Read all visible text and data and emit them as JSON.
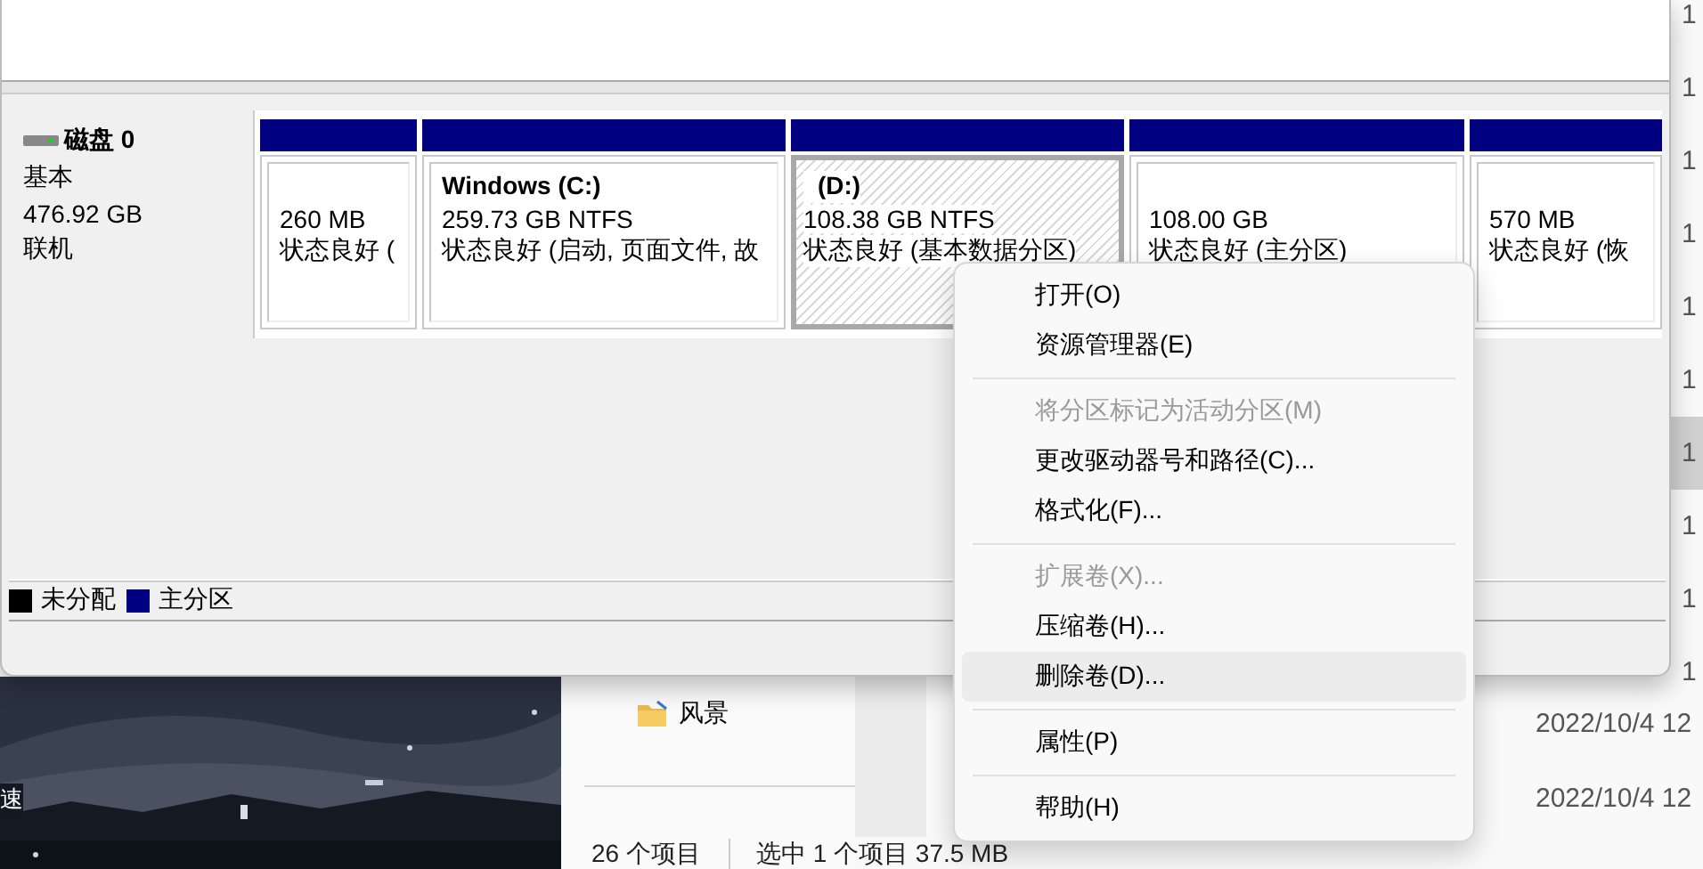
{
  "background_window": {
    "right_column": [
      {
        "text": "1",
        "selected": false
      },
      {
        "text": "1",
        "selected": false
      },
      {
        "text": "1",
        "selected": false
      },
      {
        "text": "1",
        "selected": false
      },
      {
        "text": "1",
        "selected": false
      },
      {
        "text": "1",
        "selected": false
      },
      {
        "text": "1",
        "selected": true
      },
      {
        "text": "1",
        "selected": false
      },
      {
        "text": "1",
        "selected": false
      },
      {
        "text": "1",
        "selected": false
      }
    ],
    "edge_text": "速",
    "nav_item": {
      "label": "风景"
    },
    "dates": [
      "2022/10/4 12",
      "2022/10/4 12"
    ],
    "status_bar": {
      "item_count": "26 个项目",
      "selection": "选中 1 个项目 37.5 MB"
    }
  },
  "disk_window": {
    "disk": {
      "name": "磁盘 0",
      "type": "基本",
      "size": "476.92 GB",
      "status": "联机"
    },
    "partitions": [
      {
        "size": "260 MB",
        "status": "状态良好 (",
        "selected": false
      },
      {
        "label": "Windows  (C:)",
        "size": "259.73 GB NTFS",
        "status": "状态良好 (启动, 页面文件, 故",
        "selected": false
      },
      {
        "label": "(D:)",
        "size": "108.38 GB NTFS",
        "status": "状态良好 (基本数据分区)",
        "selected": true
      },
      {
        "size": "108.00 GB",
        "status": "状态良好 (主分区)",
        "selected": false
      },
      {
        "size": "570 MB",
        "status": "状态良好 (恢",
        "selected": false
      }
    ],
    "legend": [
      {
        "label": "未分配",
        "color": "#000000"
      },
      {
        "label": "主分区",
        "color": "#000080"
      }
    ]
  },
  "context_menu": [
    {
      "kind": "item",
      "label": "打开(O)",
      "disabled": false,
      "selected": false
    },
    {
      "kind": "item",
      "label": "资源管理器(E)",
      "disabled": false,
      "selected": false
    },
    {
      "kind": "separator"
    },
    {
      "kind": "item",
      "label": "将分区标记为活动分区(M)",
      "disabled": true,
      "selected": false
    },
    {
      "kind": "item",
      "label": "更改驱动器号和路径(C)...",
      "disabled": false,
      "selected": false
    },
    {
      "kind": "item",
      "label": "格式化(F)...",
      "disabled": false,
      "selected": false
    },
    {
      "kind": "separator"
    },
    {
      "kind": "item",
      "label": "扩展卷(X)...",
      "disabled": true,
      "selected": false
    },
    {
      "kind": "item",
      "label": "压缩卷(H)...",
      "disabled": false,
      "selected": false
    },
    {
      "kind": "item",
      "label": "删除卷(D)...",
      "disabled": false,
      "selected": true
    },
    {
      "kind": "separator"
    },
    {
      "kind": "item",
      "label": "属性(P)",
      "disabled": false,
      "selected": false
    },
    {
      "kind": "separator"
    },
    {
      "kind": "item",
      "label": "帮助(H)",
      "disabled": false,
      "selected": false
    }
  ]
}
